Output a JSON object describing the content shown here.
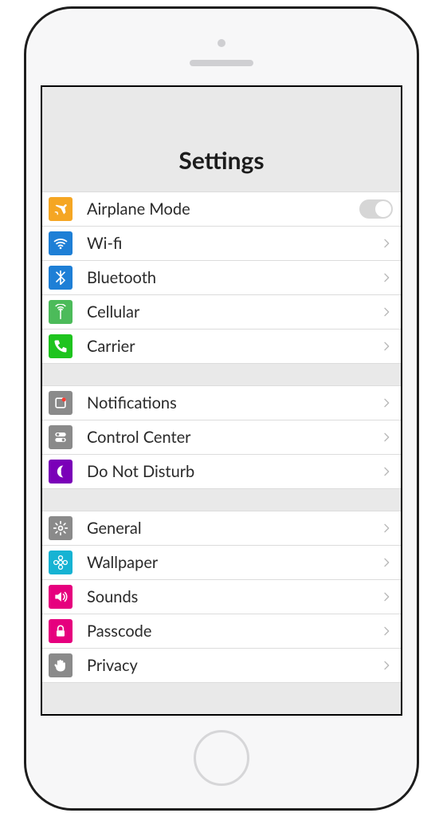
{
  "header": {
    "title": "Settings"
  },
  "groups": [
    {
      "items": [
        {
          "id": "airplane-mode",
          "label": "Airplane Mode",
          "icon": "airplane",
          "iconBg": "#F5A623",
          "accessory": "toggle"
        },
        {
          "id": "wifi",
          "label": "Wi-fi",
          "icon": "wifi",
          "iconBg": "#1E7FD6",
          "accessory": "chevron"
        },
        {
          "id": "bluetooth",
          "label": "Bluetooth",
          "icon": "bluetooth",
          "iconBg": "#1E7FD6",
          "accessory": "chevron"
        },
        {
          "id": "cellular",
          "label": "Cellular",
          "icon": "antenna",
          "iconBg": "#4CBB5A",
          "accessory": "chevron"
        },
        {
          "id": "carrier",
          "label": " Carrier",
          "icon": "phone",
          "iconBg": "#1EC41E",
          "accessory": "chevron"
        }
      ]
    },
    {
      "items": [
        {
          "id": "notifications",
          "label": "Notifications",
          "icon": "notifications",
          "iconBg": "#8A8A8A",
          "accessory": "chevron"
        },
        {
          "id": "control-center",
          "label": "Control Center",
          "icon": "switches",
          "iconBg": "#8A8A8A",
          "accessory": "chevron"
        },
        {
          "id": "do-not-disturb",
          "label": " Do Not Disturb",
          "icon": "moon",
          "iconBg": "#7A00B8",
          "accessory": "chevron"
        }
      ]
    },
    {
      "items": [
        {
          "id": "general",
          "label": "General",
          "icon": "gear",
          "iconBg": "#8A8A8A",
          "accessory": "chevron"
        },
        {
          "id": "wallpaper",
          "label": "Wallpaper",
          "icon": "flower",
          "iconBg": "#16B3D3",
          "accessory": "chevron"
        },
        {
          "id": "sounds",
          "label": "Sounds",
          "icon": "speaker",
          "iconBg": "#E6007E",
          "accessory": "chevron"
        },
        {
          "id": "passcode",
          "label": "Passcode",
          "icon": "lock",
          "iconBg": "#E6007E",
          "accessory": "chevron"
        },
        {
          "id": "privacy",
          "label": " Privacy",
          "icon": "hand",
          "iconBg": "#8A8A8A",
          "accessory": "chevron"
        }
      ]
    }
  ]
}
